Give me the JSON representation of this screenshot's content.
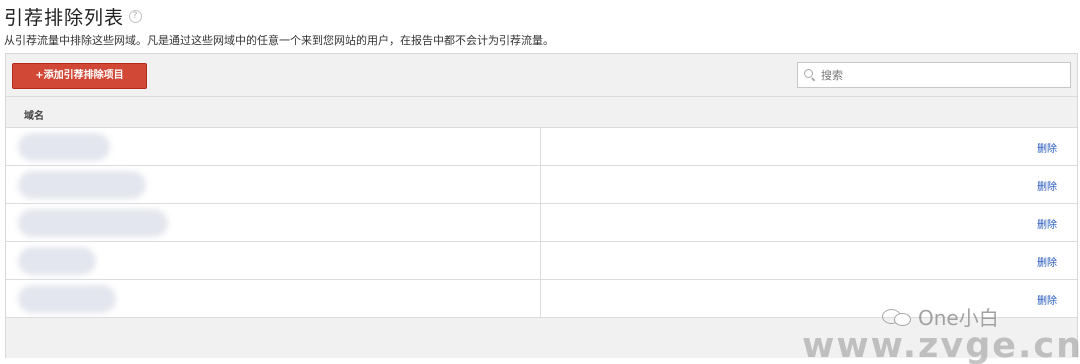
{
  "page": {
    "title": "引荐排除列表",
    "help_icon": "?",
    "description": "从引荐流量中排除这些网域。凡是通过这些网域中的任意一个来到您网站的用户，在报告中都不会计为引荐流量。"
  },
  "toolbar": {
    "add_label": "+添加引荐排除项目",
    "search_placeholder": "搜索"
  },
  "table": {
    "column_header": "域名",
    "rows": [
      {
        "domain": "",
        "action": "删除"
      },
      {
        "domain": "",
        "action": "删除"
      },
      {
        "domain": "",
        "action": "删除"
      },
      {
        "domain": "",
        "action": "删除"
      },
      {
        "domain": "",
        "action": "删除"
      }
    ]
  },
  "watermark": {
    "logo_text": "One小白",
    "url": "www.zvge.cn"
  },
  "colors": {
    "accent_button": "#d14836",
    "link": "#2255bb"
  }
}
